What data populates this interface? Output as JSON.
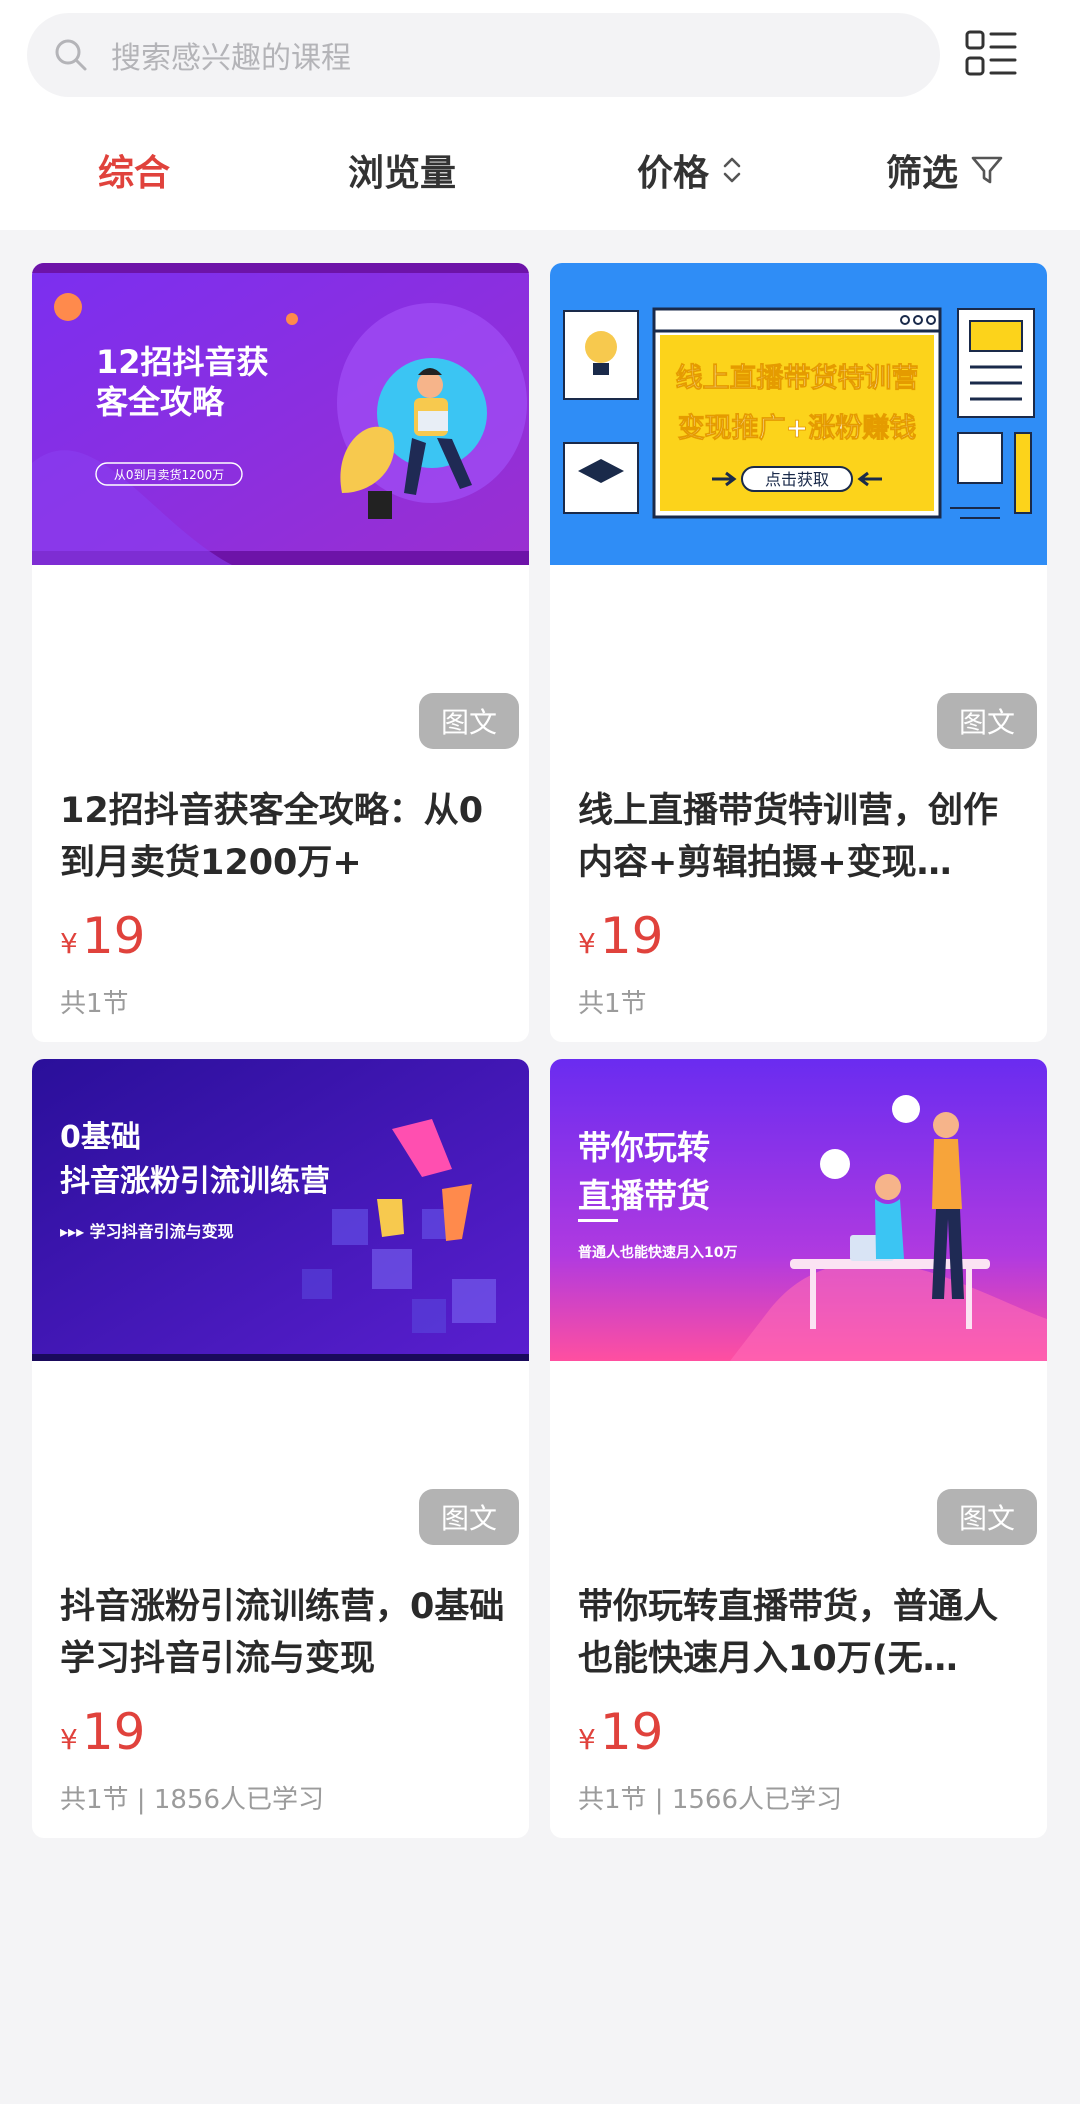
{
  "search": {
    "placeholder": "搜索感兴趣的课程"
  },
  "tabs": [
    {
      "label": "综合",
      "active": true
    },
    {
      "label": "浏览量",
      "active": false
    },
    {
      "label": "价格",
      "active": false,
      "icon": "sort-arrows-icon"
    },
    {
      "label": "筛选",
      "active": false,
      "icon": "filter-icon"
    }
  ],
  "courses": [
    {
      "cover": {
        "headline_1": "12招抖音获",
        "headline_2": "客全攻略",
        "tag": "从0到月卖货1200万"
      },
      "badge": "图文",
      "title": "12招抖音获客全攻略：从0到月卖货1200万+",
      "currency": "¥",
      "price": "19",
      "meta": "共1节"
    },
    {
      "cover": {
        "headline_1": "线上直播带货特训营",
        "headline_2": "变现推广+涨粉赚钱",
        "button": "点击获取"
      },
      "badge": "图文",
      "title": "线上直播带货特训营，创作内容+剪辑拍摄+变现…",
      "currency": "¥",
      "price": "19",
      "meta": "共1节"
    },
    {
      "cover": {
        "headline_1": "0基础",
        "headline_2": "抖音涨粉引流训练营",
        "tag": "▸▸▸ 学习抖音引流与变现"
      },
      "badge": "图文",
      "title": "抖音涨粉引流训练营，0基础学习抖音引流与变现",
      "currency": "¥",
      "price": "19",
      "meta": "共1节 | 1856人已学习"
    },
    {
      "cover": {
        "headline_1": "带你玩转",
        "headline_2": "直播带货",
        "tag": "普通人也能快速月入10万"
      },
      "badge": "图文",
      "title": "带你玩转直播带货，普通人也能快速月入10万(无…",
      "currency": "¥",
      "price": "19",
      "meta": "共1节 | 1566人已学习"
    }
  ],
  "colors": {
    "accent": "#e0423c",
    "badge": "#b3b3b3",
    "background": "#f4f4f6"
  }
}
